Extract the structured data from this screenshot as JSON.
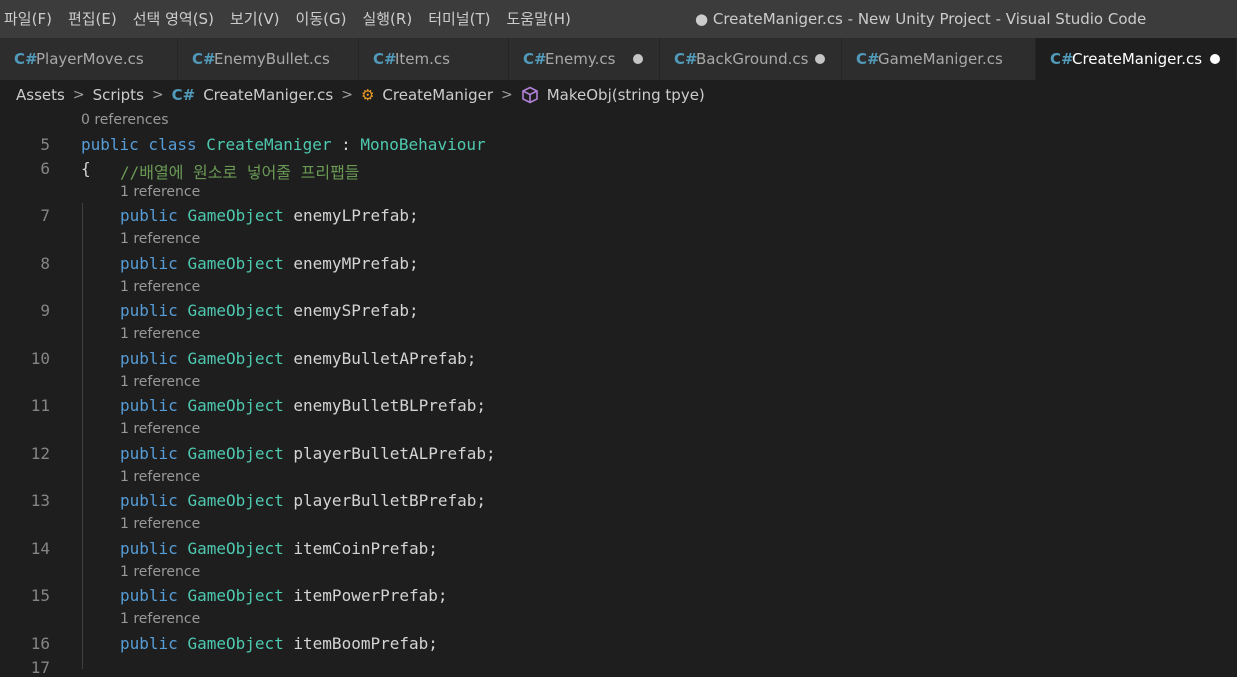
{
  "menu": [
    "파일(F)",
    "편집(E)",
    "선택 영역(S)",
    "보기(V)",
    "이동(G)",
    "실행(R)",
    "터미널(T)",
    "도움말(H)"
  ],
  "window_title": "● CreateManiger.cs - New Unity Project - Visual Studio Code",
  "tabs": [
    {
      "label": "PlayerMove.cs",
      "icon": "csharp-file-icon"
    },
    {
      "label": "EnemyBullet.cs",
      "icon": "csharp-file-icon"
    },
    {
      "label": "Item.cs",
      "icon": "csharp-file-icon"
    },
    {
      "label": "Enemy.cs",
      "icon": "csharp-file-icon",
      "modified": true
    },
    {
      "label": "BackGround.cs",
      "icon": "csharp-file-icon",
      "modified": true
    },
    {
      "label": "GameManiger.cs",
      "icon": "csharp-file-icon"
    },
    {
      "label": "CreateManiger.cs",
      "icon": "csharp-file-icon",
      "modified": true,
      "active": true
    }
  ],
  "breadcrumb": {
    "items": [
      "Assets",
      "Scripts",
      "CreateManiger.cs",
      "CreateManiger",
      "MakeObj(string tpye)"
    ]
  },
  "editor": {
    "codelens": [
      "0 references",
      "1 reference",
      "1 reference",
      "1 reference",
      "1 reference",
      "1 reference",
      "1 reference",
      "1 reference",
      "1 reference",
      "1 reference",
      "1 reference"
    ],
    "lines": [
      {
        "num": "5",
        "kw": "public class ",
        "type": "CreateManiger",
        "rest": " : ",
        "type2": "MonoBehaviour"
      },
      {
        "num": "6",
        "brace": "{",
        "comment": "//배열에 원소로 넣어줄 프리팹들"
      },
      {
        "num": "7",
        "kw": "public ",
        "type": "GameObject",
        "rest": " enemyLPrefab;"
      },
      {
        "num": "8",
        "kw": "public ",
        "type": "GameObject",
        "rest": " enemyMPrefab;"
      },
      {
        "num": "9",
        "kw": "public ",
        "type": "GameObject",
        "rest": " enemySPrefab;"
      },
      {
        "num": "10",
        "kw": "public ",
        "type": "GameObject",
        "rest": " enemyBulletAPrefab;"
      },
      {
        "num": "11",
        "kw": "public ",
        "type": "GameObject",
        "rest": " enemyBulletBLPrefab;"
      },
      {
        "num": "12",
        "kw": "public ",
        "type": "GameObject",
        "rest": " playerBulletALPrefab;"
      },
      {
        "num": "13",
        "kw": "public ",
        "type": "GameObject",
        "rest": " playerBulletBPrefab;"
      },
      {
        "num": "14",
        "kw": "public ",
        "type": "GameObject",
        "rest": " itemCoinPrefab;"
      },
      {
        "num": "15",
        "kw": "public ",
        "type": "GameObject",
        "rest": " itemPowerPrefab;"
      },
      {
        "num": "16",
        "kw": "public ",
        "type": "GameObject",
        "rest": " itemBoomPrefab;"
      },
      {
        "num": "17"
      }
    ]
  },
  "colors": {
    "keyword": "#569cd6",
    "type": "#4ec9b0",
    "comment": "#6a9955",
    "csharp_icon": "#519aba",
    "class_icon": "#ee9d28",
    "method_icon": "#b180d7"
  }
}
